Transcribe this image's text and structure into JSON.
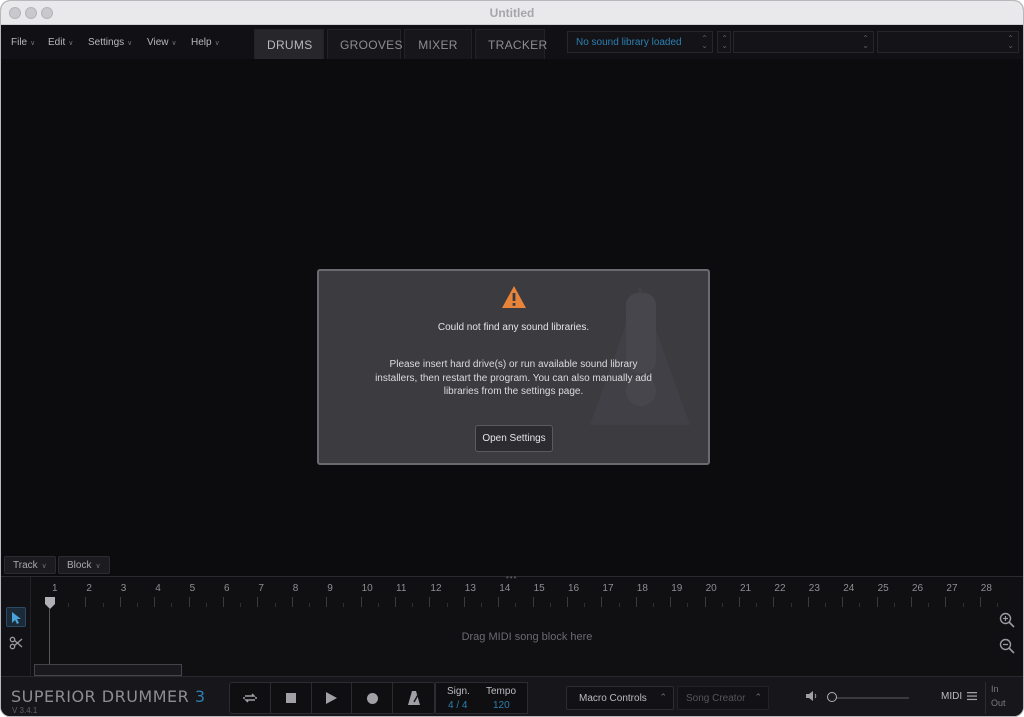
{
  "window": {
    "title": "Untitled"
  },
  "menu": {
    "items": [
      "File",
      "Edit",
      "Settings",
      "View",
      "Help"
    ]
  },
  "tabs": [
    "DRUMS",
    "GROOVES",
    "MIXER",
    "TRACKER"
  ],
  "active_tab": "DRUMS",
  "library_dropdown": {
    "value": "No sound library loaded"
  },
  "dialog": {
    "title": "Could not find any sound libraries.",
    "body": "Please insert hard drive(s) or run available sound library\ninstallers, then restart the program. You can also manually add\nlibraries from the settings page.",
    "button": "Open Settings",
    "icon": "warning-icon",
    "accent_color": "#e8833a"
  },
  "song_editor": {
    "track_menu": "Track",
    "block_menu": "Block",
    "ruler": [
      "1",
      "2",
      "3",
      "4",
      "5",
      "6",
      "7",
      "8",
      "9",
      "10",
      "11",
      "12",
      "13",
      "14",
      "15",
      "16",
      "17",
      "18",
      "19",
      "20",
      "21",
      "22",
      "23",
      "24",
      "25",
      "26",
      "27",
      "28"
    ],
    "drop_hint": "Drag MIDI song block here"
  },
  "transport": {
    "brand": {
      "name": "SUPERIOR DRUMMER",
      "number": "3"
    },
    "version": "V 3.4.1",
    "signature_label": "Sign.",
    "signature_value": "4 / 4",
    "tempo_label": "Tempo",
    "tempo_value": "120",
    "macro_controls": "Macro Controls",
    "song_creator": "Song Creator",
    "midi_label": "MIDI",
    "in_label": "In",
    "out_label": "Out",
    "accent_color": "#2c7fb0"
  }
}
